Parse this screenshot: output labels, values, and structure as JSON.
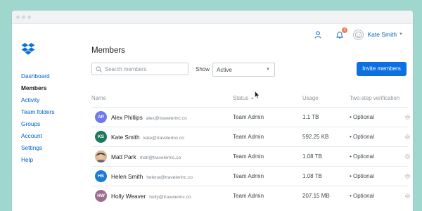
{
  "colors": {
    "background": "#9fd7cf",
    "link": "#0061c7",
    "primary_button": "#0d6fe0",
    "badge": "#f27c5a"
  },
  "topbar": {
    "user_name": "Kate Smith",
    "notification_count": "1",
    "icons": [
      "person-icon",
      "bell-icon",
      "user-avatar-icon",
      "chevron-down-icon"
    ]
  },
  "sidebar": {
    "items": [
      {
        "label": "Dashboard",
        "active": false
      },
      {
        "label": "Members",
        "active": true
      },
      {
        "label": "Activity",
        "active": false
      },
      {
        "label": "Team folders",
        "active": false
      },
      {
        "label": "Groups",
        "active": false
      },
      {
        "label": "Account",
        "active": false
      },
      {
        "label": "Settings",
        "active": false
      },
      {
        "label": "Help",
        "active": false
      }
    ]
  },
  "main": {
    "title": "Members",
    "search_placeholder": "Search members",
    "show_label": "Show",
    "show_value": "Active",
    "invite_button": "Invite members",
    "columns": [
      "Name",
      "Status",
      "Usage",
      "Two-step verification"
    ],
    "sort_column": "Status",
    "rows": [
      {
        "initials": "AP",
        "avatar_color": "#6e7be6",
        "name": "Alex Phillips",
        "email": "alex@travelerinc.co",
        "status": "Team Admin",
        "usage": "1.1 TB",
        "two_step": "• Optional"
      },
      {
        "initials": "KS",
        "avatar_color": "#1e7a5b",
        "name": "Kate Smith",
        "email": "kate@travelerinc.co",
        "status": "Team Admin",
        "usage": "592.25 KB",
        "two_step": "• Optional"
      },
      {
        "initials": "",
        "avatar_color": "#8a6b4f",
        "name": "Matt Park",
        "email": "matt@travelerinc.co",
        "status": "Team Admin",
        "usage": "1.08 TB",
        "two_step": "• Optional"
      },
      {
        "initials": "HS",
        "avatar_color": "#1d7ad0",
        "name": "Helen Smith",
        "email": "helena@travelerinc.co",
        "status": "Team Admin",
        "usage": "1.08 TB",
        "two_step": "• Optional"
      },
      {
        "initials": "HW",
        "avatar_color": "#9c6d8f",
        "name": "Holly Weaver",
        "email": "holly@travelerinc.co",
        "status": "Team Admin",
        "usage": "207.15 MB",
        "two_step": "• Optional"
      }
    ]
  }
}
